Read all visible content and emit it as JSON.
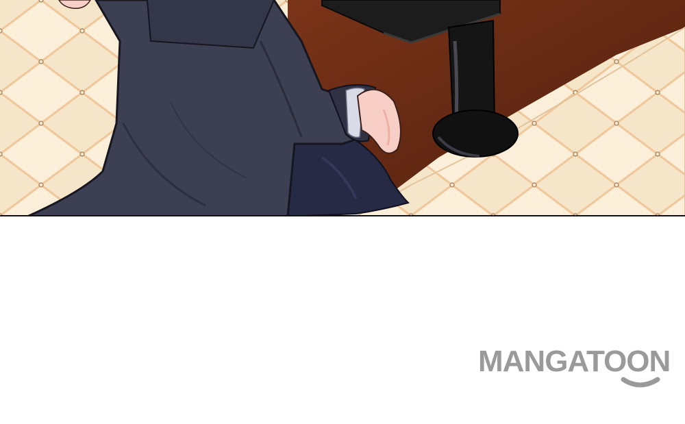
{
  "watermark": {
    "text": "MANGATOON",
    "color": "#9a9a9a"
  },
  "colors": {
    "cushion": "#f6e6c9",
    "cushion_shadow": "#e7cfa6",
    "tuft_line": "#f1c89d",
    "floor": "#6a2d17",
    "coat": "#3d3f52",
    "coat_dark": "#2a2c3a",
    "trouser": "#262a45",
    "skin": "#f7cfc6",
    "table": "#1a1a1a"
  }
}
